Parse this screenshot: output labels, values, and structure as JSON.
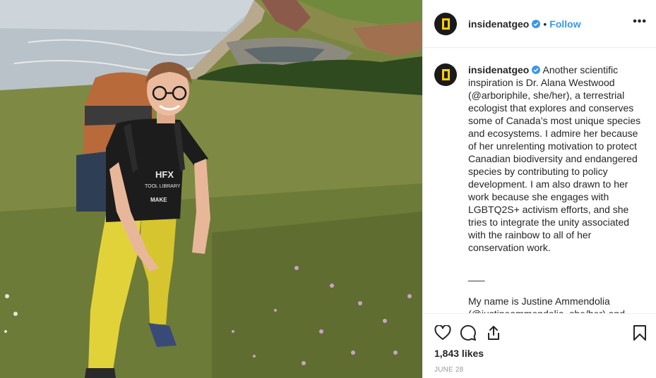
{
  "post": {
    "username": "insidenatgeo",
    "follow_label": "Follow",
    "separator": "•",
    "more_label": "•••",
    "caption_body": "Another scientific inspiration is Dr. Alana Westwood (@arboriphile, she/her), a terrestrial ecologist that explores and conserves some of Canada’s most unique species and ecosystems. I admire her because of her unrelenting motivation to protect Canadian biodiversity and endangered species by contributing to policy development. I am also drawn to her work because she engages with LGBTQ2S+ activism efforts, and she tries to integrate the unity associated with the rainbow to all of her conservation work.",
    "caption_separator": "___",
    "caption_next": "My name is Justine Ammendolia (@justineammendolia, she/her) and",
    "likes": "1,843 likes",
    "date": "JUNE 28"
  },
  "photo": {
    "shirt_text_1": "HFX",
    "shirt_text_2": "TOOL LIBRARY",
    "shirt_text_3": "MAKE"
  },
  "icons": {
    "avatar": "national-geographic-logo",
    "verified": "verified-badge-icon",
    "like": "heart-icon",
    "comment": "comment-icon",
    "share": "share-icon",
    "save": "bookmark-icon"
  },
  "colors": {
    "accent": "#3897f0",
    "logo_yellow": "#ffce00",
    "text": "#262626",
    "muted": "#999999",
    "border": "#efefef"
  }
}
